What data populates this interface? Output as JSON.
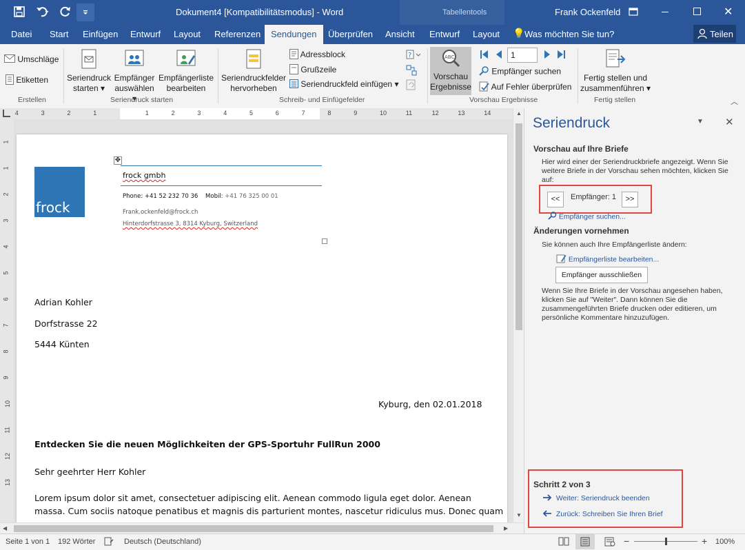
{
  "titlebar": {
    "save_icon": "save-icon",
    "undo_icon": "undo-icon",
    "redo_icon": "repeat-icon",
    "qat_icon": "customize-quick-access-icon",
    "title": "Dokument4 [Kompatibilitätsmodus]  -  Word",
    "context_tools": "Tabellentools",
    "user": "Frank Ockenfeld",
    "controls": [
      "ribbon-display-icon",
      "minimize-icon",
      "maximize-icon",
      "close-icon"
    ]
  },
  "tabs": [
    {
      "label": "Datei"
    },
    {
      "label": "Start"
    },
    {
      "label": "Einfügen"
    },
    {
      "label": "Entwurf"
    },
    {
      "label": "Layout"
    },
    {
      "label": "Referenzen"
    },
    {
      "label": "Sendungen"
    },
    {
      "label": "Überprüfen"
    },
    {
      "label": "Ansicht"
    },
    {
      "label": "Entwurf"
    },
    {
      "label": "Layout"
    }
  ],
  "tell_me": "Was möchten Sie tun?",
  "share": "Teilen",
  "ribbon": {
    "erstellen": {
      "umschlaege": "Umschläge",
      "etiketten": "Etiketten",
      "label": "Erstellen"
    },
    "starten": {
      "btn1": "Seriendruck starten",
      "btn2": "Empfänger auswählen",
      "btn3": "Empfängerliste bearbeiten",
      "label": "Seriendruck starten"
    },
    "schreib": {
      "hervorheben": "Seriendruckfelder hervorheben",
      "adressblock": "Adressblock",
      "grusszeile": "Grußzeile",
      "einfuegen": "Seriendruckfeld einfügen",
      "label": "Schreib- und Einfügefelder"
    },
    "vorschau": {
      "btn": "Vorschau Ergebnisse",
      "record": "1",
      "suchen": "Empfänger suchen",
      "fehler": "Auf Fehler überprüfen",
      "label": "Vorschau Ergebnisse"
    },
    "fertig": {
      "btn": "Fertig stellen und zusammenführen",
      "label": "Fertig stellen"
    }
  },
  "ruler_h": [
    "4",
    "3",
    "2",
    "1",
    "1",
    "2",
    "3",
    "4",
    "5",
    "6",
    "7",
    "8",
    "9",
    "10",
    "11",
    "12",
    "13",
    "14"
  ],
  "ruler_v": [
    "1",
    "1",
    "2",
    "3",
    "4",
    "5",
    "6",
    "7",
    "8",
    "9",
    "10",
    "11",
    "12",
    "13"
  ],
  "letter": {
    "logo_text": "frock",
    "company": "frock gmbh",
    "phone_label": "Phone:",
    "phone": "+41 52 232 70 36",
    "mobile_label": "Mobil:",
    "mobile": "+41 76 325 00 01",
    "email": "Frank.ockenfeld@frock.ch",
    "address": "Hinterdorfstrasse 3, 8314 Kyburg, Switzerland",
    "recipient_name": "Adrian Kohler",
    "recipient_street": "Dorfstrasse 22",
    "recipient_city": "5444 Künten",
    "date": "Kyburg, den 02.01.2018",
    "subject": "Entdecken Sie die neuen Möglichkeiten der GPS-Sportuhr FullRun 2000",
    "salutation": "Sehr geehrter Herr Kohler",
    "body_line1": "Lorem ipsum dolor sit amet, consectetuer adipiscing elit. Aenean commodo ligula eget dolor. Aenean",
    "body_line2": "massa. Cum sociis natoque penatibus et magnis dis parturient montes, nascetur ridiculus mus. Donec quam"
  },
  "pane": {
    "title": "Seriendruck",
    "h_vorschau": "Vorschau auf Ihre Briefe",
    "vorschau_text": "Hier wird einer der Seriendruckbriefe angezeigt. Wenn Sie weitere Briefe in der Vorschau sehen möchten, klicken Sie auf:",
    "prev": "<<",
    "recipient": "Empfänger: 1",
    "next": ">>",
    "suchen": "Empfänger suchen...",
    "h_aenderungen": "Änderungen vornehmen",
    "aenderungen_text": "Sie können auch Ihre Empfängerliste ändern:",
    "liste": "Empfängerliste bearbeiten...",
    "ausschliessen": "Empfänger ausschließen",
    "info": "Wenn Sie Ihre Briefe in der Vorschau angesehen haben, klicken Sie auf \"Weiter\". Dann können Sie die zusammengeführten Briefe drucken oder editieren, um persönliche Kommentare hinzuzufügen.",
    "schritt": "Schritt 2 von 3",
    "weiter": "Weiter: Seriendruck beenden",
    "zurueck": "Zurück: Schreiben Sie Ihren Brief"
  },
  "status": {
    "page": "Seite 1 von 1",
    "words": "192 Wörter",
    "language": "Deutsch (Deutschland)",
    "minus": "−",
    "plus": "+",
    "zoom": "100%",
    "zoom_level": 1.0
  },
  "colors": {
    "brand": "#2b579a",
    "logo": "#2e75b6",
    "highlight": "#e0453f"
  }
}
